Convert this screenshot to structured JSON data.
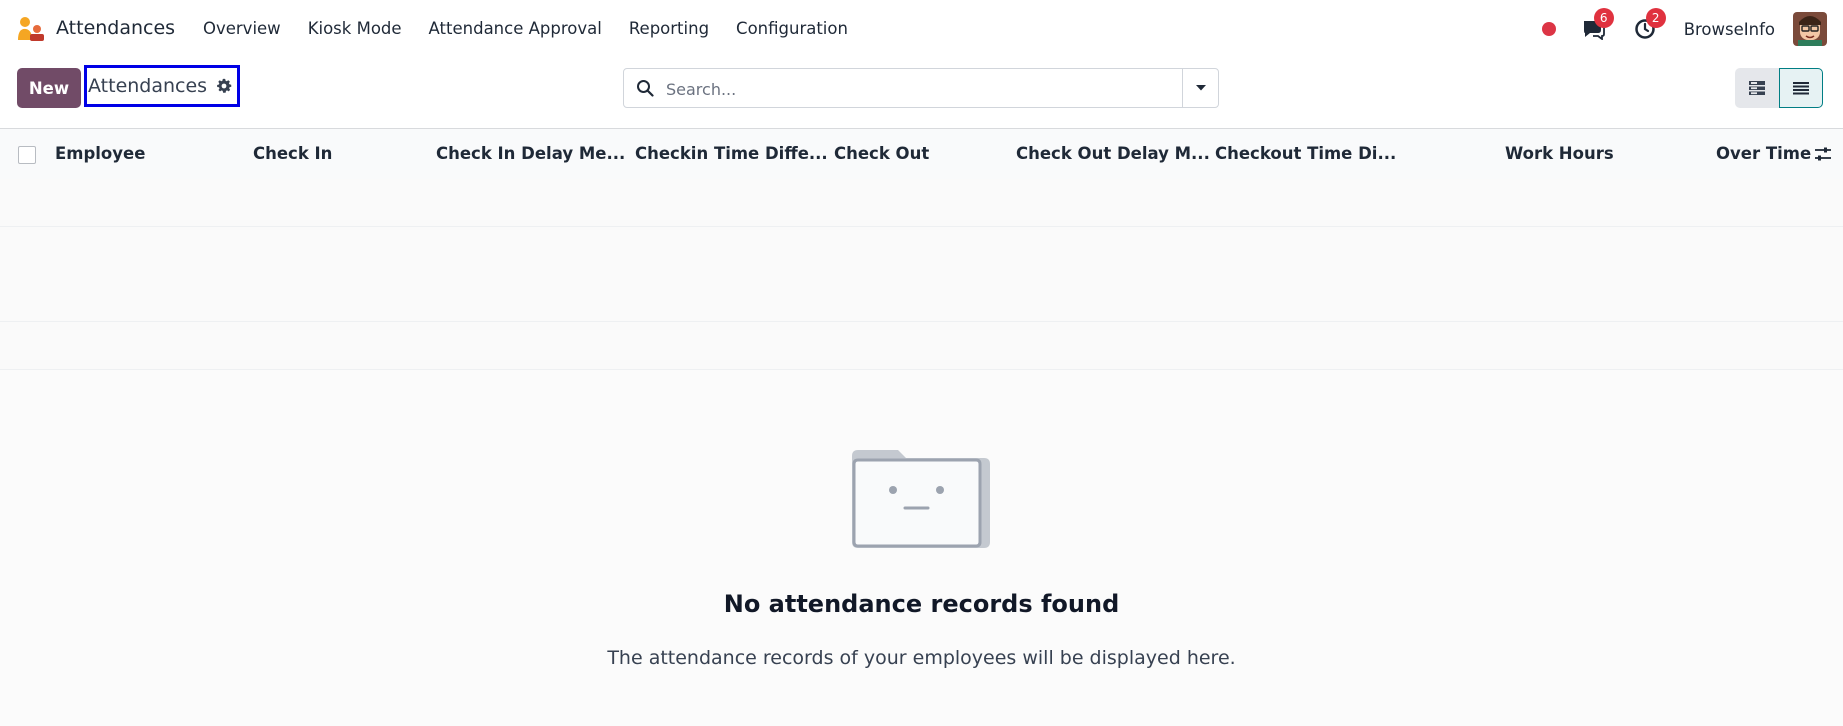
{
  "app": {
    "title": "Attendances"
  },
  "menu": [
    "Overview",
    "Kiosk Mode",
    "Attendance Approval",
    "Reporting",
    "Configuration"
  ],
  "systray": {
    "messages_badge": "6",
    "activities_badge": "2",
    "company": "BrowseInfo"
  },
  "control": {
    "new_label": "New",
    "breadcrumb": "Attendances",
    "search_placeholder": "Search..."
  },
  "list": {
    "columns": [
      "Employee",
      "Check In",
      "Check In Delay Me...",
      "Checkin Time Diffe...",
      "Check Out",
      "Check Out Delay M...",
      "Checkout Time Di...",
      "Work Hours",
      "Over Time"
    ]
  },
  "empty": {
    "title": "No attendance records found",
    "description": "The attendance records of your employees will be displayed here."
  },
  "colors": {
    "brand": "#714b67",
    "badge": "#e0323f",
    "highlight_border": "#0000e6",
    "active_view": "#017e84"
  },
  "icons": [
    "app-logo-icon",
    "chat-icon",
    "clock-icon",
    "gear-icon",
    "search-icon",
    "caret-down-icon",
    "kanban-view-icon",
    "list-view-icon",
    "column-settings-icon"
  ]
}
